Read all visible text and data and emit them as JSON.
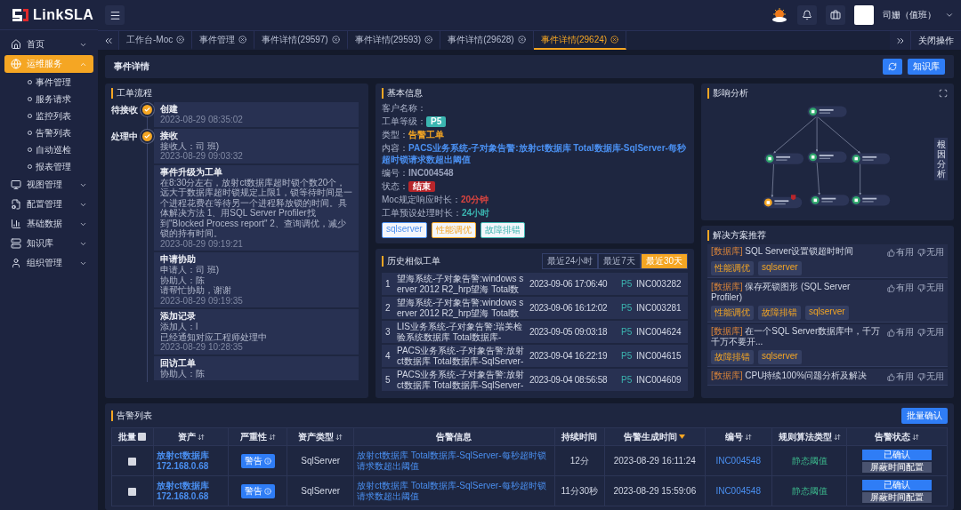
{
  "sidebar": {
    "logo": "LinkSLA",
    "items": [
      {
        "label": "首页",
        "selected": false,
        "expanded": false
      },
      {
        "label": "运维服务",
        "selected": true,
        "expanded": true,
        "children": [
          {
            "label": "事件管理",
            "selected": false
          },
          {
            "label": "服务请求",
            "selected": false
          },
          {
            "label": "监控列表",
            "selected": false
          },
          {
            "label": "告警列表",
            "selected": false
          },
          {
            "label": "自动巡检",
            "selected": false
          },
          {
            "label": "报表管理",
            "selected": false
          }
        ]
      },
      {
        "label": "视图管理",
        "selected": false,
        "expanded": false
      },
      {
        "label": "配置管理",
        "selected": false,
        "expanded": false
      },
      {
        "label": "基础数据",
        "selected": false,
        "expanded": false
      },
      {
        "label": "知识库",
        "selected": false,
        "expanded": false
      },
      {
        "label": "组织管理",
        "selected": false,
        "expanded": false
      }
    ]
  },
  "topbar": {
    "user": "司姗（值班）"
  },
  "tabs": [
    {
      "label": "工作台-Moc",
      "selected": false
    },
    {
      "label": "事件管理",
      "selected": false
    },
    {
      "label": "事件详情(29597)",
      "selected": false
    },
    {
      "label": "事件详情(29593)",
      "selected": false
    },
    {
      "label": "事件详情(29628)",
      "selected": false
    },
    {
      "label": "事件详情(29624)",
      "selected": true
    }
  ],
  "close_menu": "关闭操作",
  "header": {
    "title": "事件详情",
    "knowledge_button": "知识库"
  },
  "workflow": {
    "title": "工单流程",
    "steps": [
      {
        "stage": "待接收",
        "title": "创建",
        "time": "2023-08-29 08:35:02"
      },
      {
        "stage": "处理中",
        "title": "接收",
        "lines": [
          "接收人：司 班)"
        ],
        "time": "2023-08-29 09:03:32"
      },
      {
        "title": "事件升级为工单",
        "lines": [
          "在8:30分左右，放射ct数据库超时锁个数20个，远大于数据库超时锁规定上限1，锁等待时间是一个进程花费在等待另一个进程释放锁的时间。具体解决方法 1、用SQL Server Profiler找到\"Blocked Process report\" 2、查询调优，减少锁的持有时间。"
        ],
        "time": "2023-08-29 09:19:21"
      },
      {
        "title": "申请协助",
        "lines": [
          "申请人：司 班)",
          "协助人：陈",
          "请帮忙协助，谢谢"
        ],
        "time": "2023-08-29 09:19:35"
      },
      {
        "title": "添加记录",
        "lines": [
          "添加人：l",
          "已经通知对应工程师处理中"
        ],
        "time": "2023-08-29 10:28:35"
      },
      {
        "title": "回访工单",
        "lines": [
          "协助人：陈"
        ]
      }
    ]
  },
  "basic": {
    "title": "基本信息",
    "fields": [
      {
        "label": "客户名称：",
        "kind": "text"
      },
      {
        "label": "工单等级：",
        "value": "P5",
        "kind": "badge",
        "color": "#3bb5b0"
      },
      {
        "label": "类型：",
        "value": "告警工单",
        "kind": "text",
        "color": "#f5a623"
      },
      {
        "label": "内容：",
        "value": "PACS业务系统-子对象告警:放射ct数据库 Total数据库-SqlServer-每秒超时锁请求数超出阈值",
        "kind": "text",
        "color": "#4a8ff0"
      },
      {
        "label": "编号：",
        "value": "INC004548",
        "kind": "text",
        "color": "#9aa3bd"
      },
      {
        "label": "状态：",
        "value": "结束",
        "kind": "badge",
        "color": "#b8262b"
      },
      {
        "label": "Moc规定响应时长：",
        "value": "20分钟",
        "kind": "text",
        "color": "#d9443f"
      },
      {
        "label": "工单预设处理时长：",
        "value": "24小时",
        "kind": "text",
        "color": "#3bb5b0"
      }
    ],
    "tags": [
      {
        "label": "sqlserver",
        "color": "#4a8ff0"
      },
      {
        "label": "性能调优",
        "color": "#f5a623"
      },
      {
        "label": "故障排错",
        "color": "#3bb5b0"
      }
    ]
  },
  "history": {
    "title": "历史相似工单",
    "ranges": [
      {
        "label": "最近24小时",
        "selected": false
      },
      {
        "label": "最近7天",
        "selected": false
      },
      {
        "label": "最近30天",
        "selected": true
      }
    ],
    "rows": [
      {
        "no": "1",
        "summary": "望海系统-子对象告警:windows server 2012 R2_hrp望海 Total数",
        "time": "2023-09-06 17:06:40",
        "level": "P5",
        "id": "INC003282"
      },
      {
        "no": "2",
        "summary": "望海系统-子对象告警:windows server 2012 R2_hrp望海 Total数",
        "time": "2023-09-06 16:12:02",
        "level": "P5",
        "id": "INC003281"
      },
      {
        "no": "3",
        "summary": "LIS业务系统-子对象告警:瑞美检验系统数据库 Total数据库-",
        "time": "2023-09-05 09:03:18",
        "level": "P5",
        "id": "INC004624"
      },
      {
        "no": "4",
        "summary": "PACS业务系统-子对象告警:放射ct数据库 Total数据库-SqlServer-",
        "time": "2023-09-04 16:22:19",
        "level": "P5",
        "id": "INC004615"
      },
      {
        "no": "5",
        "summary": "PACS业务系统-子对象告警:放射ct数据库 Total数据库-SqlServer-",
        "time": "2023-09-04 08:56:58",
        "level": "P5",
        "id": "INC004609"
      }
    ]
  },
  "impact": {
    "title": "影响分析",
    "root_cause": "根因分析"
  },
  "solutions": {
    "title": "解决方案推荐",
    "items": [
      {
        "category": "[数据库]",
        "title": "SQL Server设置锁超时时间",
        "tags": [
          "性能调优",
          "sqlserver"
        ],
        "up": "有用",
        "down": "无用"
      },
      {
        "category": "[数据库]",
        "title": "保存死锁图形 (SQL Server Profiler)",
        "tags": [
          "性能调优",
          "故障排错",
          "sqlserver"
        ],
        "up": "有用",
        "down": "无用"
      },
      {
        "category": "[数据库]",
        "title": "在一个SQL Server数据库中，千万千万不要开...",
        "tags": [
          "故障排错",
          "sqlserver"
        ],
        "up": "有用",
        "down": "无用"
      },
      {
        "category": "[数据库]",
        "title": "CPU持续100%问题分析及解决",
        "up": "有用",
        "down": "无用"
      }
    ]
  },
  "alerts": {
    "title": "告警列表",
    "confirm_all": "批量确认",
    "select_all": false,
    "columns": [
      {
        "label": "批量"
      },
      {
        "label": "资产",
        "sortable": true
      },
      {
        "label": "严重性",
        "sortable": true
      },
      {
        "label": "资产类型",
        "sortable": true
      },
      {
        "label": "告警信息"
      },
      {
        "label": "持续时间"
      },
      {
        "label": "告警生成时间",
        "sorted": true
      },
      {
        "label": "编号",
        "sortable": true
      },
      {
        "label": "规则算法类型",
        "sortable": true
      },
      {
        "label": "告警状态",
        "sortable": true
      }
    ],
    "rows": [
      {
        "checked": false,
        "asset": "放射ct数据库",
        "ip": "172.168.0.68",
        "severity": "警告",
        "type": "SqlServer",
        "message": "放射ct数据库 Total数据库-SqlServer-每秒超时锁请求数超出阈值",
        "duration": "12分",
        "time": "2023-08-29 16:11:24",
        "id": "INC004548",
        "rule": "静态阈值",
        "status": "已确认",
        "action": "屏蔽时间配置"
      },
      {
        "checked": false,
        "asset": "放射ct数据库",
        "ip": "172.168.0.68",
        "severity": "警告",
        "type": "SqlServer",
        "message": "放射ct数据库 Total数据库-SqlServer-每秒超时锁请求数超出阈值",
        "duration": "11分30秒",
        "time": "2023-08-29 15:59:06",
        "id": "INC004548",
        "rule": "静态阈值",
        "status": "已确认",
        "action": "屏蔽时间配置"
      }
    ]
  }
}
